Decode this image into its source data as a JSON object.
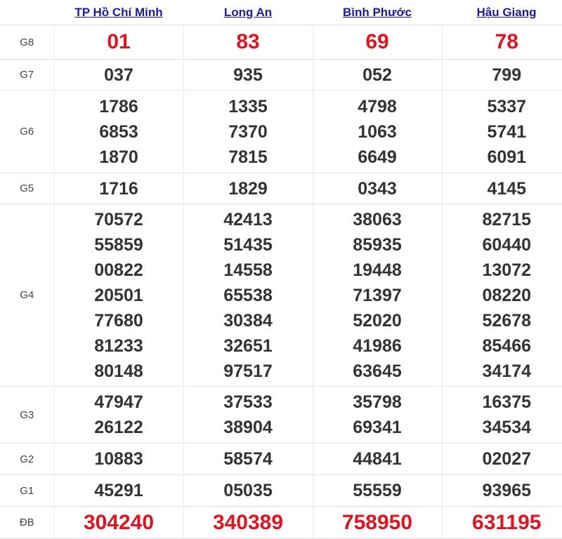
{
  "provinces": [
    "TP Hồ Chí Minh",
    "Long An",
    "Bình Phước",
    "Hậu Giang"
  ],
  "labels": {
    "g8": "G8",
    "g7": "G7",
    "g6": "G6",
    "g5": "G5",
    "g4": "G4",
    "g3": "G3",
    "g2": "G2",
    "g1": "G1",
    "db": "ĐB"
  },
  "results": {
    "g8": [
      [
        "01"
      ],
      [
        "83"
      ],
      [
        "69"
      ],
      [
        "78"
      ]
    ],
    "g7": [
      [
        "037"
      ],
      [
        "935"
      ],
      [
        "052"
      ],
      [
        "799"
      ]
    ],
    "g6": [
      [
        "1786",
        "6853",
        "1870"
      ],
      [
        "1335",
        "7370",
        "7815"
      ],
      [
        "4798",
        "1063",
        "6649"
      ],
      [
        "5337",
        "5741",
        "6091"
      ]
    ],
    "g5": [
      [
        "1716"
      ],
      [
        "1829"
      ],
      [
        "0343"
      ],
      [
        "4145"
      ]
    ],
    "g4": [
      [
        "70572",
        "55859",
        "00822",
        "20501",
        "77680",
        "81233",
        "80148"
      ],
      [
        "42413",
        "51435",
        "14558",
        "65538",
        "30384",
        "32651",
        "97517"
      ],
      [
        "38063",
        "85935",
        "19448",
        "71397",
        "52020",
        "41986",
        "63645"
      ],
      [
        "82715",
        "60440",
        "13072",
        "08220",
        "52678",
        "85466",
        "34174"
      ]
    ],
    "g3": [
      [
        "47947",
        "26122"
      ],
      [
        "37533",
        "38904"
      ],
      [
        "35798",
        "69341"
      ],
      [
        "16375",
        "34534"
      ]
    ],
    "g2": [
      [
        "10883"
      ],
      [
        "58574"
      ],
      [
        "44841"
      ],
      [
        "02027"
      ]
    ],
    "g1": [
      [
        "45291"
      ],
      [
        "05035"
      ],
      [
        "55559"
      ],
      [
        "93965"
      ]
    ],
    "db": [
      [
        "304240"
      ],
      [
        "340389"
      ],
      [
        "758950"
      ],
      [
        "631195"
      ]
    ]
  },
  "colors": {
    "link": "#1a1aa6",
    "highlight": "#e0141e",
    "text": "#333333"
  }
}
